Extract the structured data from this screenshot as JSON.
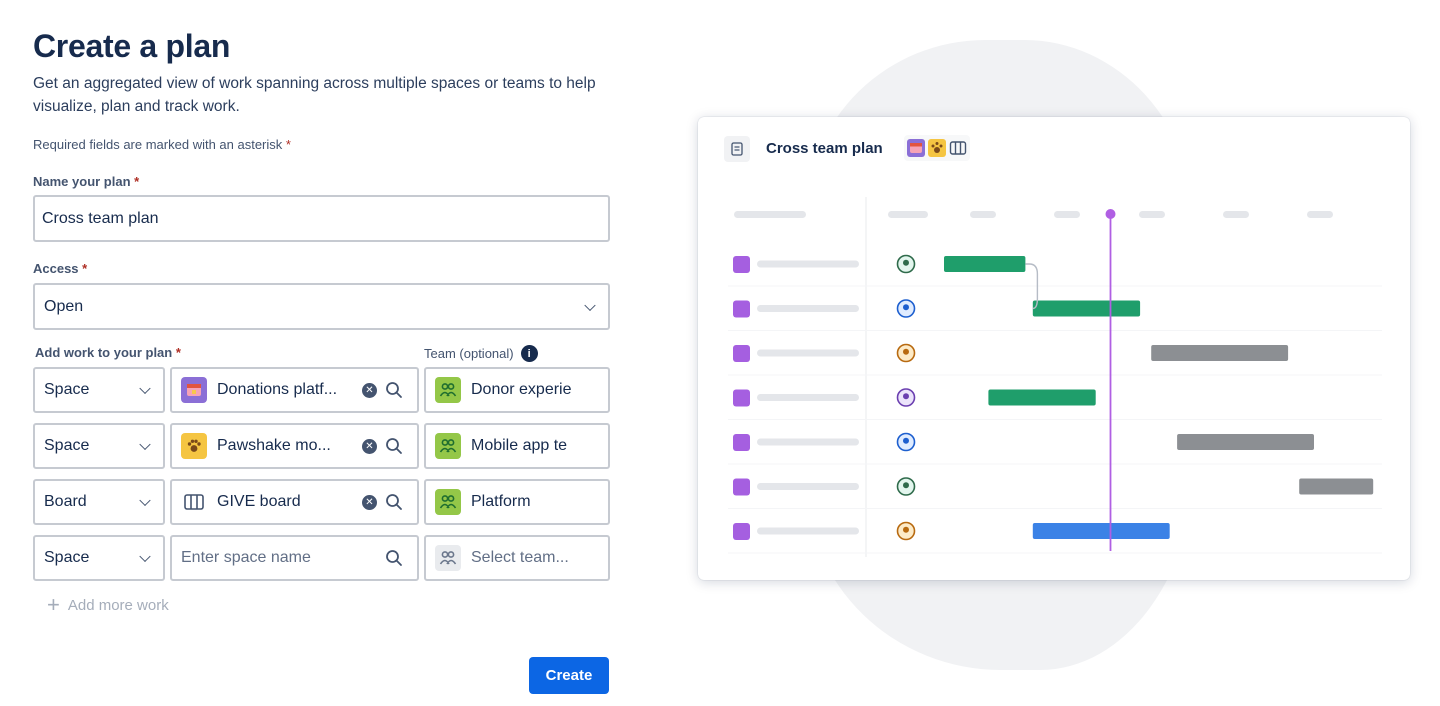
{
  "page": {
    "title": "Create a plan",
    "subtitle": "Get an aggregated view of work spanning across multiple spaces or teams to help visualize, plan and track work.",
    "required_note": "Required fields are marked with an asterisk",
    "required_marker": "*"
  },
  "form": {
    "name_label": "Name your plan",
    "name_value": "Cross team plan",
    "access_label": "Access",
    "access_value": "Open",
    "work_label": "Add work to your plan",
    "team_label": "Team (optional)",
    "rows": [
      {
        "type": "Space",
        "source": "Donations platf...",
        "source_icon": "donations-space-icon",
        "team": "Donor experie",
        "team_placeholder": false,
        "has_clear": true
      },
      {
        "type": "Space",
        "source": "Pawshake mo...",
        "source_icon": "paw-space-icon",
        "team": "Mobile app te",
        "team_placeholder": false,
        "has_clear": true
      },
      {
        "type": "Board",
        "source": "GIVE board",
        "source_icon": "board-icon",
        "team": "Platform",
        "team_placeholder": false,
        "has_clear": true
      },
      {
        "type": "Space",
        "source": "Enter space name",
        "source_icon": "none",
        "team": "Select team...",
        "team_placeholder": true,
        "has_clear": false
      }
    ],
    "add_more_label": "Add more work",
    "create_label": "Create"
  },
  "preview": {
    "title": "Cross team plan",
    "today_line_color": "#b05fe3",
    "rows": [
      {
        "avatar": "person-green",
        "bar_color": "#1f9e6b",
        "start": 0.0,
        "end": 0.22
      },
      {
        "avatar": "person-blue",
        "bar_color": "#1f9e6b",
        "start": 0.24,
        "end": 0.53
      },
      {
        "avatar": "person-orange",
        "bar_color": "#8c8f93",
        "start": 0.56,
        "end": 0.93
      },
      {
        "avatar": "person-purple",
        "bar_color": "#1f9e6b",
        "start": 0.12,
        "end": 0.41
      },
      {
        "avatar": "person-blue",
        "bar_color": "#8c8f93",
        "start": 0.63,
        "end": 1.0
      },
      {
        "avatar": "person-green",
        "bar_color": "#8c8f93",
        "start": 0.96,
        "end": 1.16
      },
      {
        "avatar": "person-orange",
        "bar_color": "#3b82e6",
        "start": 0.24,
        "end": 0.61
      }
    ],
    "today_position": 0.45
  },
  "colors": {
    "primary": "#0c66e4",
    "required": "#ae2e24",
    "item_square": "#a55fe0"
  }
}
